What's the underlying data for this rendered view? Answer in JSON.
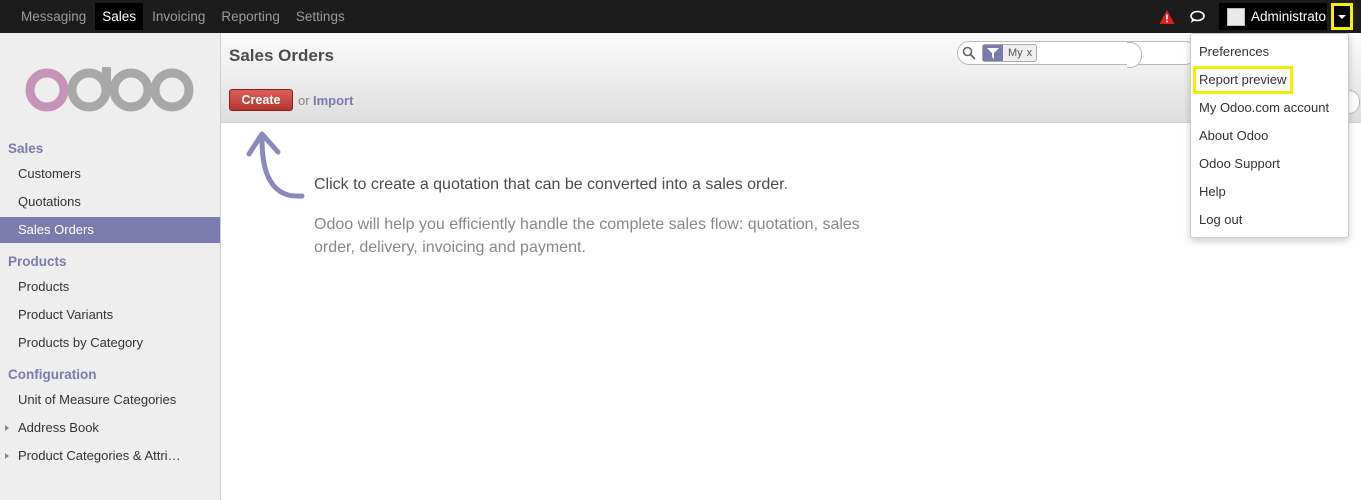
{
  "topnav": {
    "items": [
      {
        "label": "Messaging"
      },
      {
        "label": "Sales"
      },
      {
        "label": "Invoicing"
      },
      {
        "label": "Reporting"
      },
      {
        "label": "Settings"
      }
    ],
    "active": "Sales"
  },
  "user": {
    "name": "Administrator"
  },
  "colors": {
    "accent": "#7c7bad",
    "create": "#c0392b",
    "highlight": "#f5f000",
    "topbar": "#1c1c1c"
  },
  "sidebar": {
    "sections": [
      {
        "title": "Sales",
        "items": [
          "Customers",
          "Quotations",
          "Sales Orders"
        ]
      },
      {
        "title": "Products",
        "items": [
          "Products",
          "Product Variants",
          "Products by Category"
        ]
      },
      {
        "title": "Configuration",
        "items": [
          "Unit of Measure Categories",
          "Address Book",
          "Product Categories & Attributes"
        ]
      }
    ],
    "active_item": "Sales Orders"
  },
  "control_panel": {
    "title": "Sales Orders",
    "create_label": "Create",
    "or_label": "or",
    "import_label": "Import",
    "search": {
      "facet_label": "My",
      "facet_remove": "x"
    }
  },
  "help": {
    "main": "Click to create a quotation that can be converted into a sales order.",
    "sub": "Odoo will help you efficiently handle the complete sales flow: quotation, sales order, delivery, invoicing and payment."
  },
  "user_menu": {
    "items": [
      "Preferences",
      "Report preview",
      "My Odoo.com account",
      "About Odoo",
      "Odoo Support",
      "Help",
      "Log out"
    ],
    "highlighted": "Report preview"
  }
}
